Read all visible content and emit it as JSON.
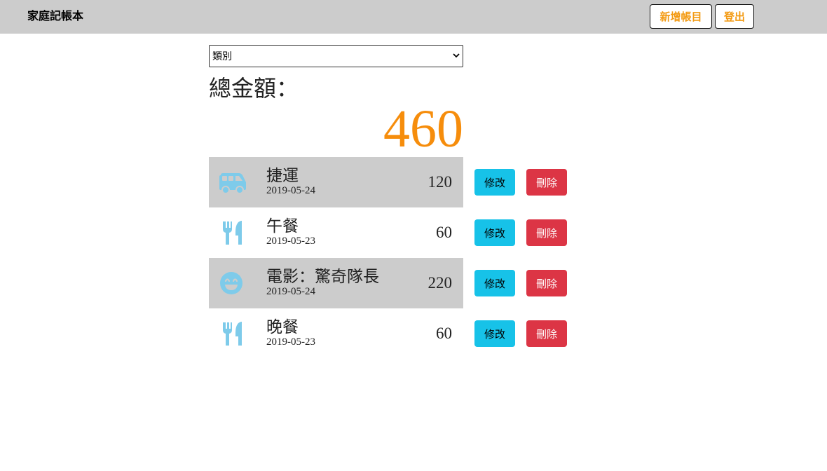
{
  "navbar": {
    "brand": "家庭記帳本",
    "add_label": "新增帳目",
    "logout_label": "登出"
  },
  "filter": {
    "selected": "類別"
  },
  "summary": {
    "label": "總金額：",
    "total": "460"
  },
  "entries": [
    {
      "title": "捷運",
      "date": "2019-05-24",
      "amount": "120",
      "icon": "bus-icon",
      "edit_label": "修改",
      "delete_label": "刪除"
    },
    {
      "title": "午餐",
      "date": "2019-05-23",
      "amount": "60",
      "icon": "utensils-icon",
      "edit_label": "修改",
      "delete_label": "刪除"
    },
    {
      "title": "電影：驚奇隊長",
      "date": "2019-05-24",
      "amount": "220",
      "icon": "smile-icon",
      "edit_label": "修改",
      "delete_label": "刪除"
    },
    {
      "title": "晚餐",
      "date": "2019-05-23",
      "amount": "60",
      "icon": "utensils-icon",
      "edit_label": "修改",
      "delete_label": "刪除"
    }
  ],
  "colors": {
    "accent": "#f68d0c",
    "icon": "#7ecbea",
    "edit": "#17c2e8",
    "delete": "#dc3545",
    "header": "#cccccc"
  }
}
